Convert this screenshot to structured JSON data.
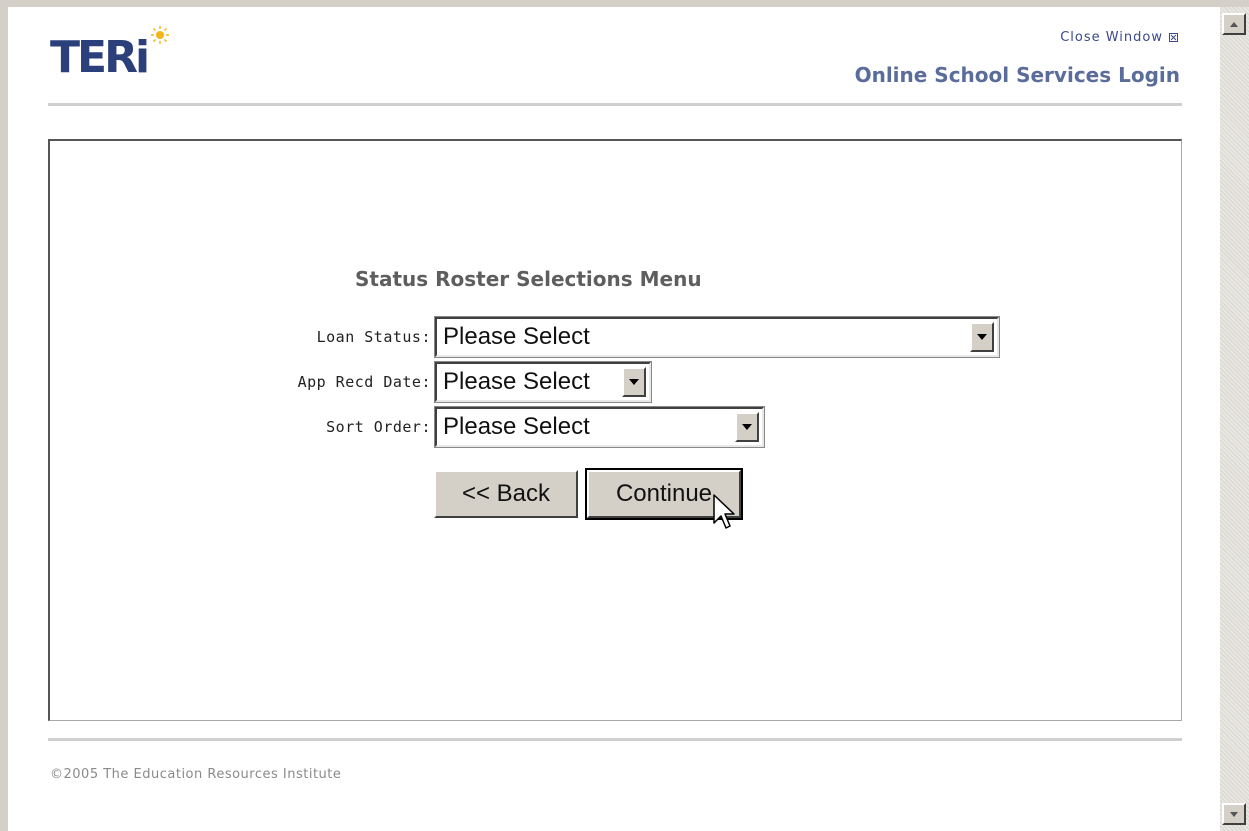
{
  "header": {
    "logo_text": "TERi",
    "close_label": "Close Window",
    "title": "Online School Services Login"
  },
  "form": {
    "title": "Status Roster Selections Menu",
    "fields": [
      {
        "label": "Loan Status:",
        "value": "Please Select"
      },
      {
        "label": "App Recd Date:",
        "value": "Please Select"
      },
      {
        "label": "Sort Order:",
        "value": "Please Select"
      }
    ],
    "back_label": "<< Back",
    "continue_label": "Continue"
  },
  "footer": {
    "copyright": "©2005 The Education Resources Institute"
  },
  "colors": {
    "brand_navy": "#2b3f7a",
    "header_title": "#5a6c99",
    "sun": "#f2b51a",
    "button_face": "#d4d0c8"
  },
  "icons": {
    "close": "close-x-box-icon",
    "dropdown": "chevron-down-icon",
    "cursor": "mouse-pointer-icon"
  }
}
